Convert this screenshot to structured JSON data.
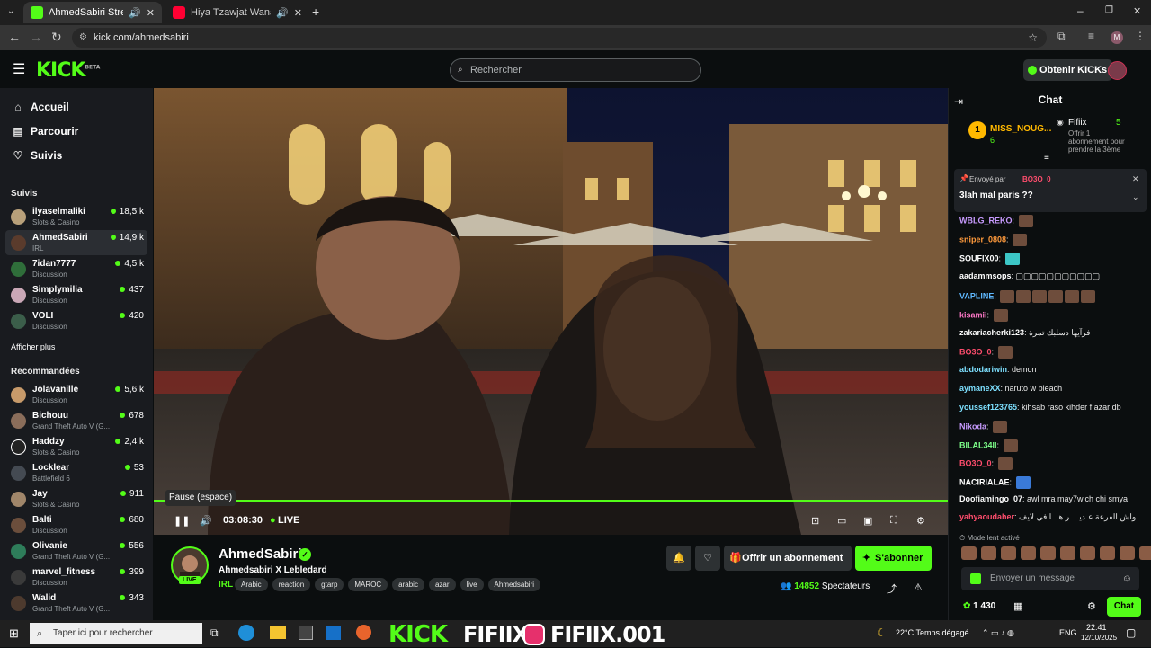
{
  "browser": {
    "tabs": [
      {
        "title": "AhmedSabiri Stream - Watc",
        "active": true
      },
      {
        "title": "Hiya Tzawjat Wana Nghbne",
        "active": false
      }
    ],
    "url": "kick.com/ahmedsabiri",
    "profile_initial": "M"
  },
  "header": {
    "logo": "KICK",
    "logo_badge": "BETA",
    "search_placeholder": "Rechercher",
    "get_kicks_label": "Obtenir KICKs"
  },
  "sidebar": {
    "nav": [
      {
        "label": "Accueil",
        "icon": "home-icon"
      },
      {
        "label": "Parcourir",
        "icon": "browse-icon"
      },
      {
        "label": "Suivis",
        "icon": "heart-icon"
      }
    ],
    "followed_title": "Suivis",
    "followed": [
      {
        "name": "ilyaselmaliki",
        "category": "Slots & Casino",
        "viewers": "18,5 k"
      },
      {
        "name": "AhmedSabiri",
        "category": "IRL",
        "viewers": "14,9 k"
      },
      {
        "name": "7idan7777",
        "category": "Discussion",
        "viewers": "4,5 k"
      },
      {
        "name": "Simplymilia",
        "category": "Discussion",
        "viewers": "437"
      },
      {
        "name": "VOLI",
        "category": "Discussion",
        "viewers": "420"
      }
    ],
    "show_more": "Afficher plus",
    "recommended_title": "Recommandées",
    "recommended": [
      {
        "name": "Jolavanille",
        "category": "Discussion",
        "viewers": "5,6 k"
      },
      {
        "name": "Bichouu",
        "category": "Grand Theft Auto V (G...",
        "viewers": "678"
      },
      {
        "name": "Haddzy",
        "category": "Slots & Casino",
        "viewers": "2,4 k"
      },
      {
        "name": "Locklear",
        "category": "Battlefield 6",
        "viewers": "53"
      },
      {
        "name": "Jay",
        "category": "Slots & Casino",
        "viewers": "911"
      },
      {
        "name": "Balti",
        "category": "Discussion",
        "viewers": "680"
      },
      {
        "name": "Olivanie",
        "category": "Grand Theft Auto V (G...",
        "viewers": "556"
      },
      {
        "name": "marvel_fitness",
        "category": "Discussion",
        "viewers": "399"
      },
      {
        "name": "Walid",
        "category": "Grand Theft Auto V (G...",
        "viewers": "343"
      }
    ]
  },
  "player": {
    "tooltip": "Pause (espace)",
    "time": "03:08:30",
    "live_label": "LIVE",
    "progress": 1.0
  },
  "channel": {
    "name": "AhmedSabiri",
    "live_badge": "LIVE",
    "stream_title": "Ahmedsabiri X Lebledard",
    "category": "IRL",
    "tags": [
      "Arabic",
      "reaction",
      "gtarp",
      "MAROC",
      "arabic",
      "azar",
      "live",
      "Ahmedsabiri"
    ],
    "gift_label": "Offrir un abonnement",
    "subscribe_label": "S'abonner",
    "viewers_count": "14852",
    "viewers_label": "Spectateurs"
  },
  "chat": {
    "title": "Chat",
    "leaderboard": {
      "rank": "1",
      "top_user": "MISS_NOUG...",
      "top_count": "6",
      "gifter": "Fifiix",
      "gifter_count": "5",
      "gift_note_1": "Offrir 1",
      "gift_note_2": "abonnement pour",
      "gift_note_3": "prendre la 3ème"
    },
    "pinned": {
      "sent_by": "Envoyé par",
      "author": "BO3O_0",
      "message": "3lah mal paris ??"
    },
    "messages": [
      {
        "user": "WBLG_REKO",
        "text": "",
        "color": "#c89bff",
        "emote": true
      },
      {
        "user": "sniper_0808",
        "text": "",
        "color": "#ff9a3c",
        "emote": true
      },
      {
        "user": "SOUFIX00",
        "text": "",
        "color": "#ffffff",
        "emote": true
      },
      {
        "user": "aadammsops",
        "text": "▢▢▢▢▢▢▢▢▢▢▢",
        "color": "#ffffff",
        "emote": false
      },
      {
        "user": "VAPLINE",
        "text": "",
        "color": "#5fb8ff",
        "emote": true
      },
      {
        "user": "kisamii",
        "text": "",
        "color": "#ff78c8",
        "emote": true
      },
      {
        "user": "zakariacherki123",
        "text": "فرآيها دسلبك تمرة",
        "color": "#ffffff",
        "emote": false
      },
      {
        "user": "BO3O_0",
        "text": "",
        "color": "#ff4d6d",
        "emote": true
      },
      {
        "user": "abdodariwin",
        "text": "demon",
        "color": "#7de0ff",
        "emote": false
      },
      {
        "user": "aymaneXX",
        "text": "naruto w bleach",
        "color": "#7de0ff",
        "emote": false
      },
      {
        "user": "youssef123765",
        "text": "kihsab raso kihder f azar db",
        "color": "#7de0ff",
        "emote": false
      },
      {
        "user": "Nikoda",
        "text": "",
        "color": "#c89bff",
        "emote": true
      },
      {
        "user": "BILAL34ll",
        "text": "",
        "color": "#7dff8a",
        "emote": true
      },
      {
        "user": "BO3O_0",
        "text": "",
        "color": "#ff4d6d",
        "emote": true
      },
      {
        "user": "NACIRIALAE",
        "text": "",
        "color": "#ffffff",
        "emote": true
      },
      {
        "user": "Doofiamingo_07",
        "text": "awl mra may7wich chi smya",
        "color": "#ffffff",
        "emote": false
      },
      {
        "user": "yahyaoudaher",
        "text": "واش الفرعة عـديــــر هـــا في لايف",
        "color": "#ff4d6d",
        "emote": false
      }
    ],
    "slow_mode": "Mode lent activé",
    "input_placeholder": "Envoyer un message",
    "points": "1 430",
    "send_label": "Chat"
  },
  "taskbar": {
    "search_placeholder": "Taper ici pour rechercher",
    "overlay_kick": "KICK",
    "overlay_name": "FIFIIX",
    "overlay_ig": "FIFIIX.001",
    "weather": "22°C  Temps dégagé",
    "lang": "ENG",
    "time": "22:41",
    "date": "12/10/2025"
  }
}
